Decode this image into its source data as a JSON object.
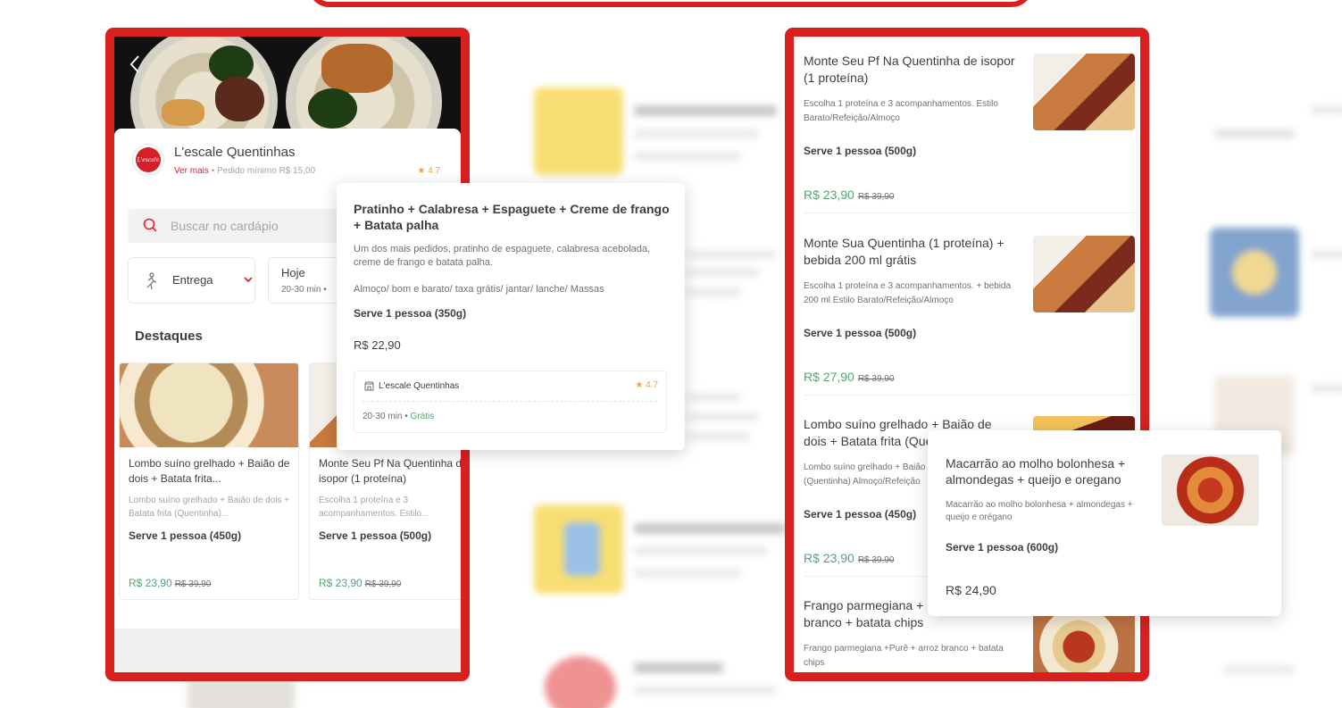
{
  "left_phone": {
    "store": {
      "name": "L'escale Quentinhas",
      "logo_text": "L'escale",
      "see_more": "Ver mais",
      "min_order": "• Pedido mínimo R$ 15,00",
      "rating": "4.7"
    },
    "search": {
      "placeholder": "Buscar no cardápio"
    },
    "delivery": {
      "label": "Entrega"
    },
    "schedule": {
      "day": "Hoje",
      "eta": "20-30 min •"
    },
    "section_title": "Destaques",
    "highlights": [
      {
        "title": "Lombo suíno grelhado + Baião de dois + Batata frita...",
        "desc": "Lombo suíno grelhado + Baião de dois + Batata frita (Quentinha)...",
        "serve": "Serve 1 pessoa (450g)",
        "price": "R$ 23,90",
        "old_price": "R$ 39,90"
      },
      {
        "title": "Monte Seu Pf Na Quentinha de isopor (1 proteína)",
        "desc": "Escolha 1 proteína e 3 acompanhamentos. Estilo...",
        "serve": "Serve 1 pessoa (500g)",
        "price": "R$ 23,90",
        "old_price": "R$ 39,90"
      }
    ]
  },
  "popup_left": {
    "title": "Pratinho + Calabresa + Espaguete + Creme de frango + Batata palha",
    "desc": "Um dos mais pedidos, pratinho de espaguete, calabresa acebolada, creme de frango e batata palha.",
    "tags": "Almoço/ bom e barato/ taxa grátis/ jantar/ lanche/ Massas",
    "serve": "Serve 1 pessoa (350g)",
    "price": "R$ 22,90",
    "store_name": "L'escale Quentinhas",
    "store_rating": "4.7",
    "eta": "20-30 min",
    "eta_sep": "•",
    "delivery_fee": "Grátis"
  },
  "right_phone": {
    "items": [
      {
        "title": "Monte Seu Pf Na Quentinha de isopor (1 proteína)",
        "desc": "Escolha 1 proteína e 3 acompanhamentos. Estilo Barato/Refeição/Almoço",
        "serve": "Serve 1 pessoa (500g)",
        "price": "R$ 23,90",
        "old_price": "R$ 39,90"
      },
      {
        "title": "Monte Sua Quentinha (1 proteína) + bebida 200 ml grátis",
        "desc": "Escolha 1 proteína e 3 acompanhamentos. + bebida 200 ml Estilo Barato/Refeição/Almoço",
        "serve": "Serve 1 pessoa (500g)",
        "price": "R$ 27,90",
        "old_price": "R$ 39,90"
      },
      {
        "title": "Lombo suíno grelhado + Baião de dois + Batata frita (Quentinha)",
        "desc": "Lombo suíno grelhado + Baião de dois + Batata frita (Quentinha) Almoço/Refeição",
        "serve": "Serve 1 pessoa (450g)",
        "price": "R$ 23,90",
        "old_price": "R$ 39,90"
      },
      {
        "title": "Frango parmegiana + Purê + arroz branco + batata chips",
        "desc": "Frango parmegiana +Purê + arroz branco + batata chips",
        "serve": "",
        "price": "",
        "old_price": ""
      }
    ]
  },
  "popup_right": {
    "title": "Macarrão ao molho bolonhesa + almondegas + queijo e oregano",
    "desc": "Macarrão ao molho bolonhesa + almondegas + queijo e orégano",
    "serve": "Serve 1 pessoa (600g)",
    "price": "R$ 24,90"
  },
  "colors": {
    "brand_red": "#d9201f",
    "price_green": "#50a773",
    "rating_gold": "#e7a74e"
  },
  "icons": [
    "chevron-left-icon",
    "search-icon",
    "delivery-person-icon",
    "chevron-down-icon",
    "star-icon",
    "store-icon"
  ]
}
